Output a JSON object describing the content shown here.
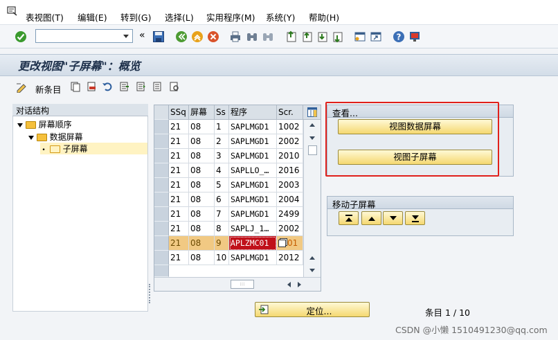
{
  "menubar": {
    "items": [
      "表视图(T)",
      "编辑(E)",
      "转到(G)",
      "选择(L)",
      "实用程序(M)",
      "系统(Y)",
      "帮助(H)"
    ]
  },
  "toolbar": {
    "command_value": "",
    "icons": [
      "enter-icon",
      "save-icon",
      "back-icon",
      "exit-icon",
      "cancel-icon",
      "print-icon",
      "find-icon",
      "find-next-icon",
      "first-page-icon",
      "prev-page-icon",
      "next-page-icon",
      "last-page-icon",
      "new-session-icon",
      "shortcut-icon",
      "help-icon",
      "customize-icon"
    ]
  },
  "title": "更改视图\"子屏幕\"：概览",
  "app_toolbar": {
    "new_entries": "新条目"
  },
  "tree": {
    "header": "对话结构",
    "items": [
      "屏幕顺序",
      "数据屏幕",
      "子屏幕"
    ]
  },
  "grid": {
    "columns": [
      "SSq",
      "屏幕",
      "Ss",
      "程序",
      "Scr."
    ],
    "rows": [
      [
        "21",
        "08",
        "1",
        "SAPLMGD1",
        "1002"
      ],
      [
        "21",
        "08",
        "2",
        "SAPLMGD1",
        "2002"
      ],
      [
        "21",
        "08",
        "3",
        "SAPLMGD1",
        "2010"
      ],
      [
        "21",
        "08",
        "4",
        "SAPLLO_…",
        "2016"
      ],
      [
        "21",
        "08",
        "5",
        "SAPLMGD1",
        "2003"
      ],
      [
        "21",
        "08",
        "6",
        "SAPLMGD1",
        "2004"
      ],
      [
        "21",
        "08",
        "7",
        "SAPLMGD1",
        "2499"
      ],
      [
        "21",
        "08",
        "8",
        "SAPLJ_1…",
        "2002"
      ],
      [
        "21",
        "08",
        "9",
        "APLZMC01",
        "01"
      ],
      [
        "21",
        "08",
        "10",
        "SAPLMGD1",
        "2012"
      ]
    ],
    "selected_row": 9
  },
  "view_group": {
    "title": "查看...",
    "btn_data_screen": "视图数据屏幕",
    "btn_sub_screen": "视图子屏幕"
  },
  "move_group": {
    "title": "移动子屏幕"
  },
  "locate_btn": "定位...",
  "entry_info": "条目 1 / 10",
  "watermark": "CSDN @小懒 1510491230@qq.com",
  "colors": {
    "highlight_row": "#f1c983",
    "selected_cell": "#c0101a",
    "red_annotation": "#e0201b",
    "button_yellow": "#f5d870"
  }
}
